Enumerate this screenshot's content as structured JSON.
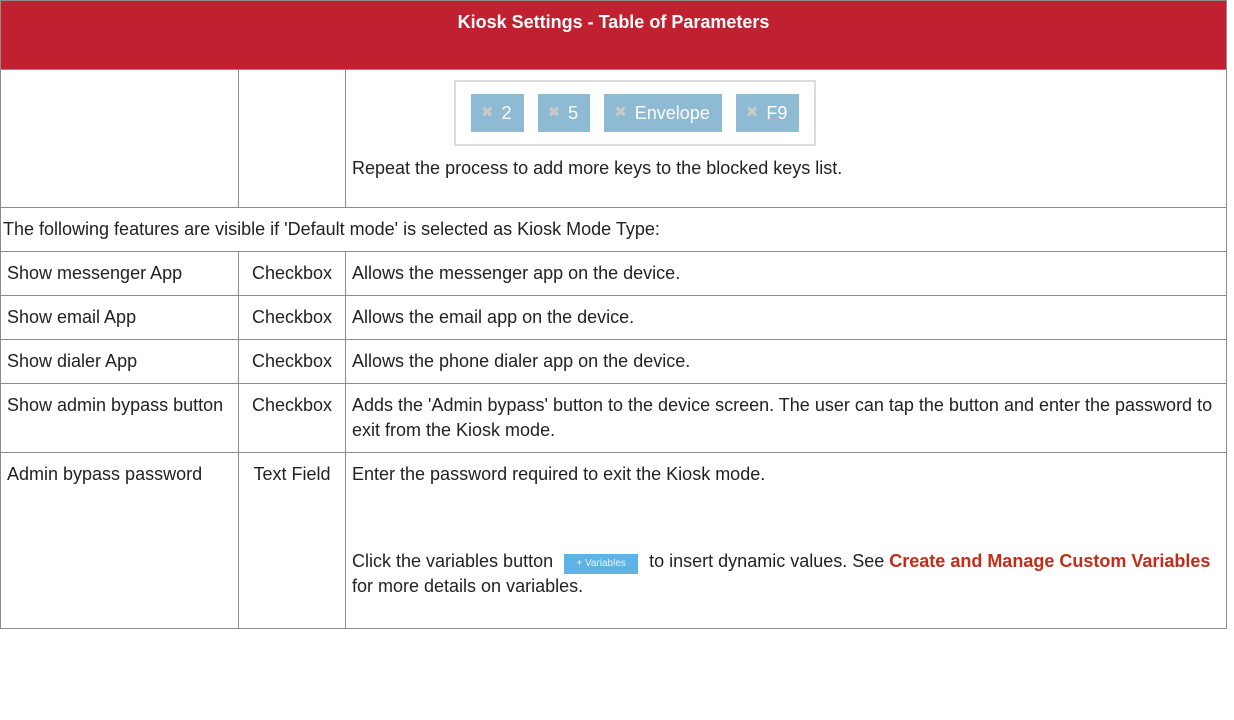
{
  "table": {
    "title": "Kiosk Settings - Table of Parameters",
    "blocked_keys": [
      "2",
      "5",
      "Envelope",
      "F9"
    ],
    "repeat_note": "Repeat the process to add more keys to the blocked keys list.",
    "default_mode_note": "The following features are visible if 'Default mode' is selected as Kiosk Mode Type:",
    "rows": [
      {
        "name": "Show messenger App",
        "type": "Checkbox",
        "desc": "Allows the messenger app on the device."
      },
      {
        "name": "Show email App",
        "type": "Checkbox",
        "desc": "Allows the email app on the device."
      },
      {
        "name": "Show dialer App",
        "type": "Checkbox",
        "desc": "Allows the phone dialer app on the device."
      },
      {
        "name": "Show admin bypass button",
        "type": "Checkbox",
        "desc": "Adds the 'Admin bypass' button to the device screen. The user can tap the button and enter the password to exit from the Kiosk mode."
      },
      {
        "name": "Admin bypass password",
        "type": "Text Field",
        "desc": "Enter the password required to exit the Kiosk mode."
      }
    ],
    "variables": {
      "before": "Click the variables button",
      "button_label": "+ Variables",
      "after": "to insert dynamic values. See",
      "link_text": "Create and Manage Custom Variables",
      "tail": "for more details on variables."
    }
  }
}
